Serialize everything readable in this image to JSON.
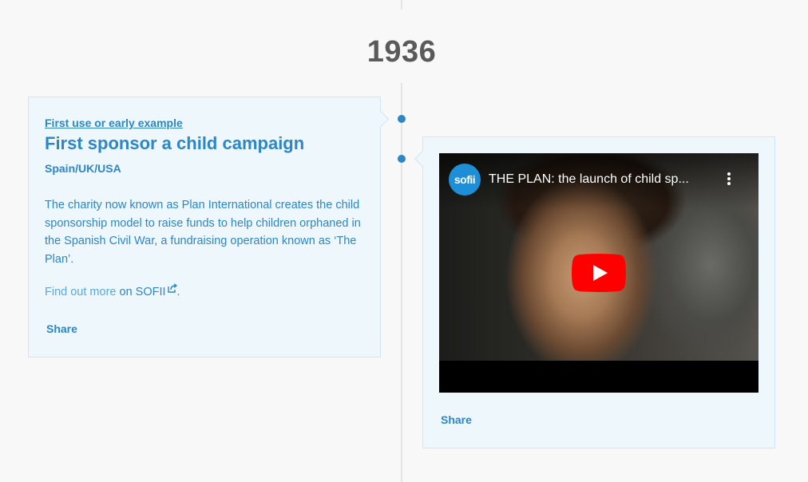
{
  "timeline": {
    "year": "1936"
  },
  "entry": {
    "category": "First use or early example",
    "title": "First sponsor a child campaign",
    "location": "Spain/UK/USA",
    "description": "The charity now known as Plan International creates the child sponsorship model to raise funds to help children orphaned in the Spanish Civil War, a fundraising operation known as ‘The Plan’.",
    "find_out_more": "Find out more",
    "on_text": "on",
    "source_link": "SOFII",
    "period": ".",
    "share_label": "Share"
  },
  "video": {
    "title": "THE PLAN: the launch of child sp...",
    "channel_logo_text": "sofii",
    "share_label": "Share"
  },
  "colors": {
    "accent": "#2d86c6",
    "card_bg": "#eef7fc",
    "card_border": "#cfe6f4",
    "year_text": "#5a5a5a",
    "play_red": "#ff0000"
  },
  "icons": {
    "external_link": "external-link-icon",
    "play": "play-icon",
    "menu": "more-vert-icon"
  }
}
